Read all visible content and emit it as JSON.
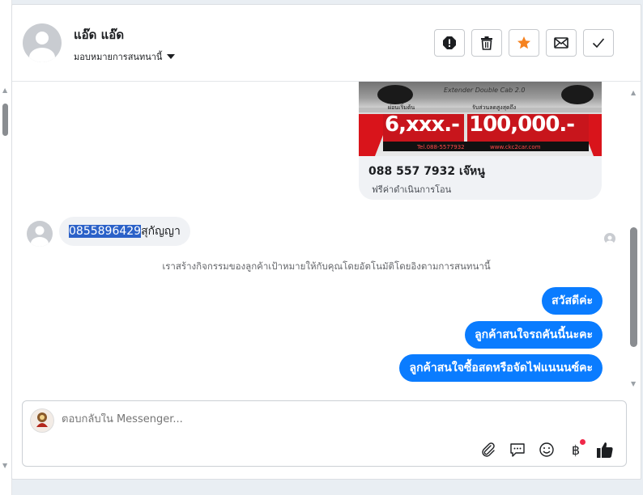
{
  "header": {
    "contact_name": "แอ๊ด แอ๊ด",
    "assign_label": "มอบหมายการสนทนานี้",
    "actions": [
      "report-icon",
      "trash-icon",
      "star-icon",
      "envelope-icon",
      "check-icon"
    ]
  },
  "card": {
    "banner_model": "Extender Double Cab 2.0",
    "banner_tag_left": "ผ่อนเริ่มต้น",
    "banner_price_left": "6,xxx.-",
    "banner_tag_right": "รับส่วนลดสูงสุดถึง",
    "banner_price_right": "100,000.-",
    "banner_tel": "Tel.088-5577932",
    "banner_web": "www.ckc2car.com",
    "title": "088 557 7932 เจ๊หนู",
    "subtitle": "ฟรีค่าดำเนินการโอน"
  },
  "incoming": {
    "phone_highlighted": "0855896429",
    "name_text": "สุกัญญา"
  },
  "system_message": "เราสร้างกิจกรรมของลูกค้าเป้าหมายให้กับคุณโดยอัตโนมัติโดยอิงตามการสนทนานี้",
  "outgoing": [
    "สวัสดีค่ะ",
    "ลูกค้าสนใจรถคันนี้นะคะ",
    "ลูกค้าสนใจซื้อสดหรือจัดไฟแนนนซ์คะ"
  ],
  "composer": {
    "placeholder": "ตอบกลับใน Messenger...",
    "tools": [
      "paperclip-icon",
      "saved-reply-icon",
      "emoji-icon",
      "baht-icon",
      "thumbs-up-icon"
    ],
    "baht_symbol": "฿",
    "notification_color": "#f02849"
  },
  "colors": {
    "accent": "#0a7cff",
    "star": "#f5821f",
    "highlight": "#2b61c8"
  }
}
